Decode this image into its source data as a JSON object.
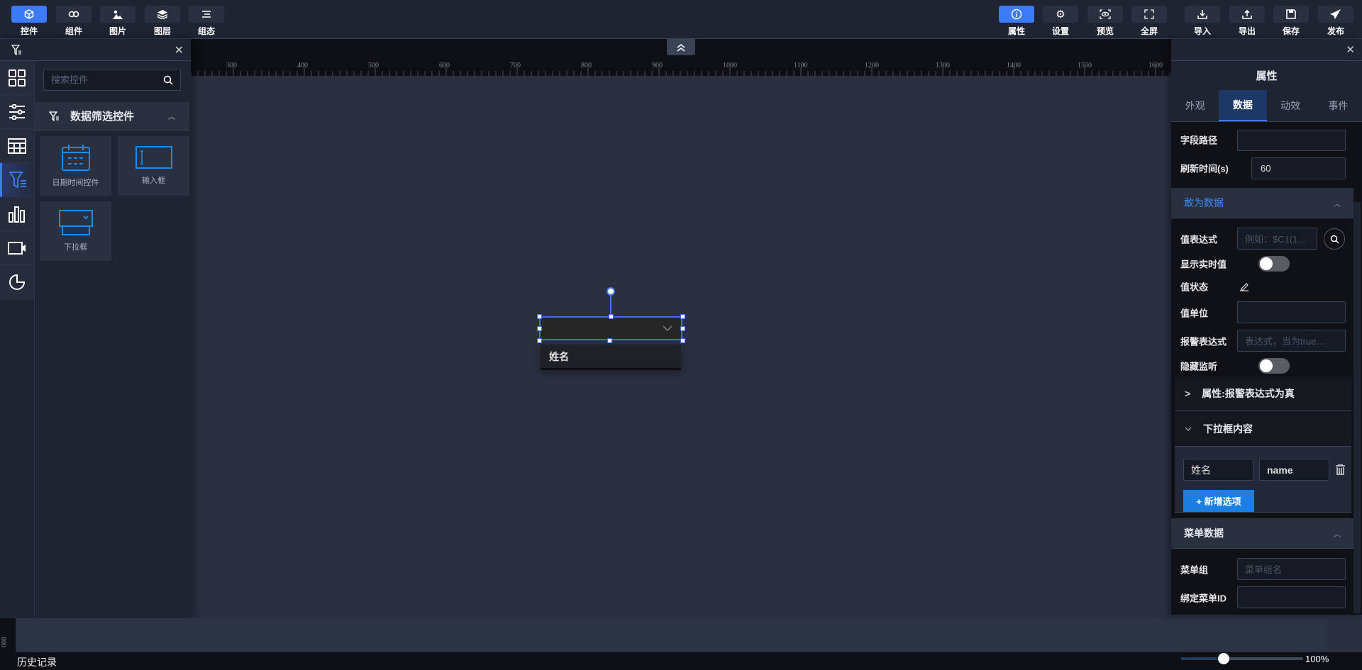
{
  "toolbar": {
    "left": [
      {
        "label": "控件",
        "icon": "cube-icon",
        "active": true
      },
      {
        "label": "组件",
        "icon": "link-icon"
      },
      {
        "label": "图片",
        "icon": "image-icon"
      },
      {
        "label": "图层",
        "icon": "layers-icon"
      },
      {
        "label": "组态",
        "icon": "align-icon"
      }
    ],
    "right": [
      {
        "label": "属性",
        "icon": "info-icon",
        "active": true
      },
      {
        "label": "设置",
        "icon": "gear-icon"
      },
      {
        "label": "预览",
        "icon": "eye-icon"
      },
      {
        "label": "全屏",
        "icon": "fullscreen-icon"
      },
      {
        "label": "导入",
        "icon": "import-icon"
      },
      {
        "label": "导出",
        "icon": "export-icon"
      },
      {
        "label": "保存",
        "icon": "save-icon"
      },
      {
        "label": "发布",
        "icon": "send-icon"
      }
    ]
  },
  "left_panel": {
    "search_placeholder": "搜索控件",
    "category": "数据筛选控件",
    "items": [
      {
        "label": "日期时间控件"
      },
      {
        "label": "输入框"
      },
      {
        "label": "下拉框"
      }
    ]
  },
  "ruler": {
    "ticks": [
      "300",
      "400",
      "500",
      "600",
      "700",
      "800",
      "900",
      "1000",
      "1100",
      "1200",
      "1300",
      "1400",
      "1500",
      "1600"
    ],
    "vertical_tick": "800"
  },
  "canvas": {
    "dropdown_option": "姓名"
  },
  "right_panel": {
    "title": "属性",
    "tabs": [
      {
        "label": "外观"
      },
      {
        "label": "数据",
        "active": true
      },
      {
        "label": "动效"
      },
      {
        "label": "事件"
      }
    ],
    "field_path_label": "字段路径",
    "field_path_value": "",
    "refresh_label": "刷新时间(s)",
    "refresh_value": "60",
    "section1": "敢为数据",
    "value_expr_label": "值表达式",
    "value_expr_placeholder": "例如：$C1(1...",
    "show_realtime_label": "显示实时值",
    "show_realtime_on": false,
    "value_state_label": "值状态",
    "value_unit_label": "值单位",
    "alarm_expr_label": "报警表达式",
    "alarm_expr_placeholder": "表达式，当为true...",
    "hide_listen_label": "隐藏监听",
    "hide_listen_on": false,
    "collapse1": "属性:报警表达式为真",
    "collapse2": "下拉框内容",
    "option_label": "姓名",
    "option_value": "name",
    "add_option": "+ 新增选项",
    "section2": "菜单数据",
    "menu_group_label": "菜单组",
    "menu_group_placeholder": "菜单组名",
    "menu_id_label": "绑定菜单ID"
  },
  "footer": {
    "history": "历史记录",
    "zoom": "100%",
    "zoom_level": 1.0
  },
  "colors": {
    "accent": "#3c7bf5",
    "add_button": "#1a7fe0",
    "section_title": "#3c8cf0"
  }
}
